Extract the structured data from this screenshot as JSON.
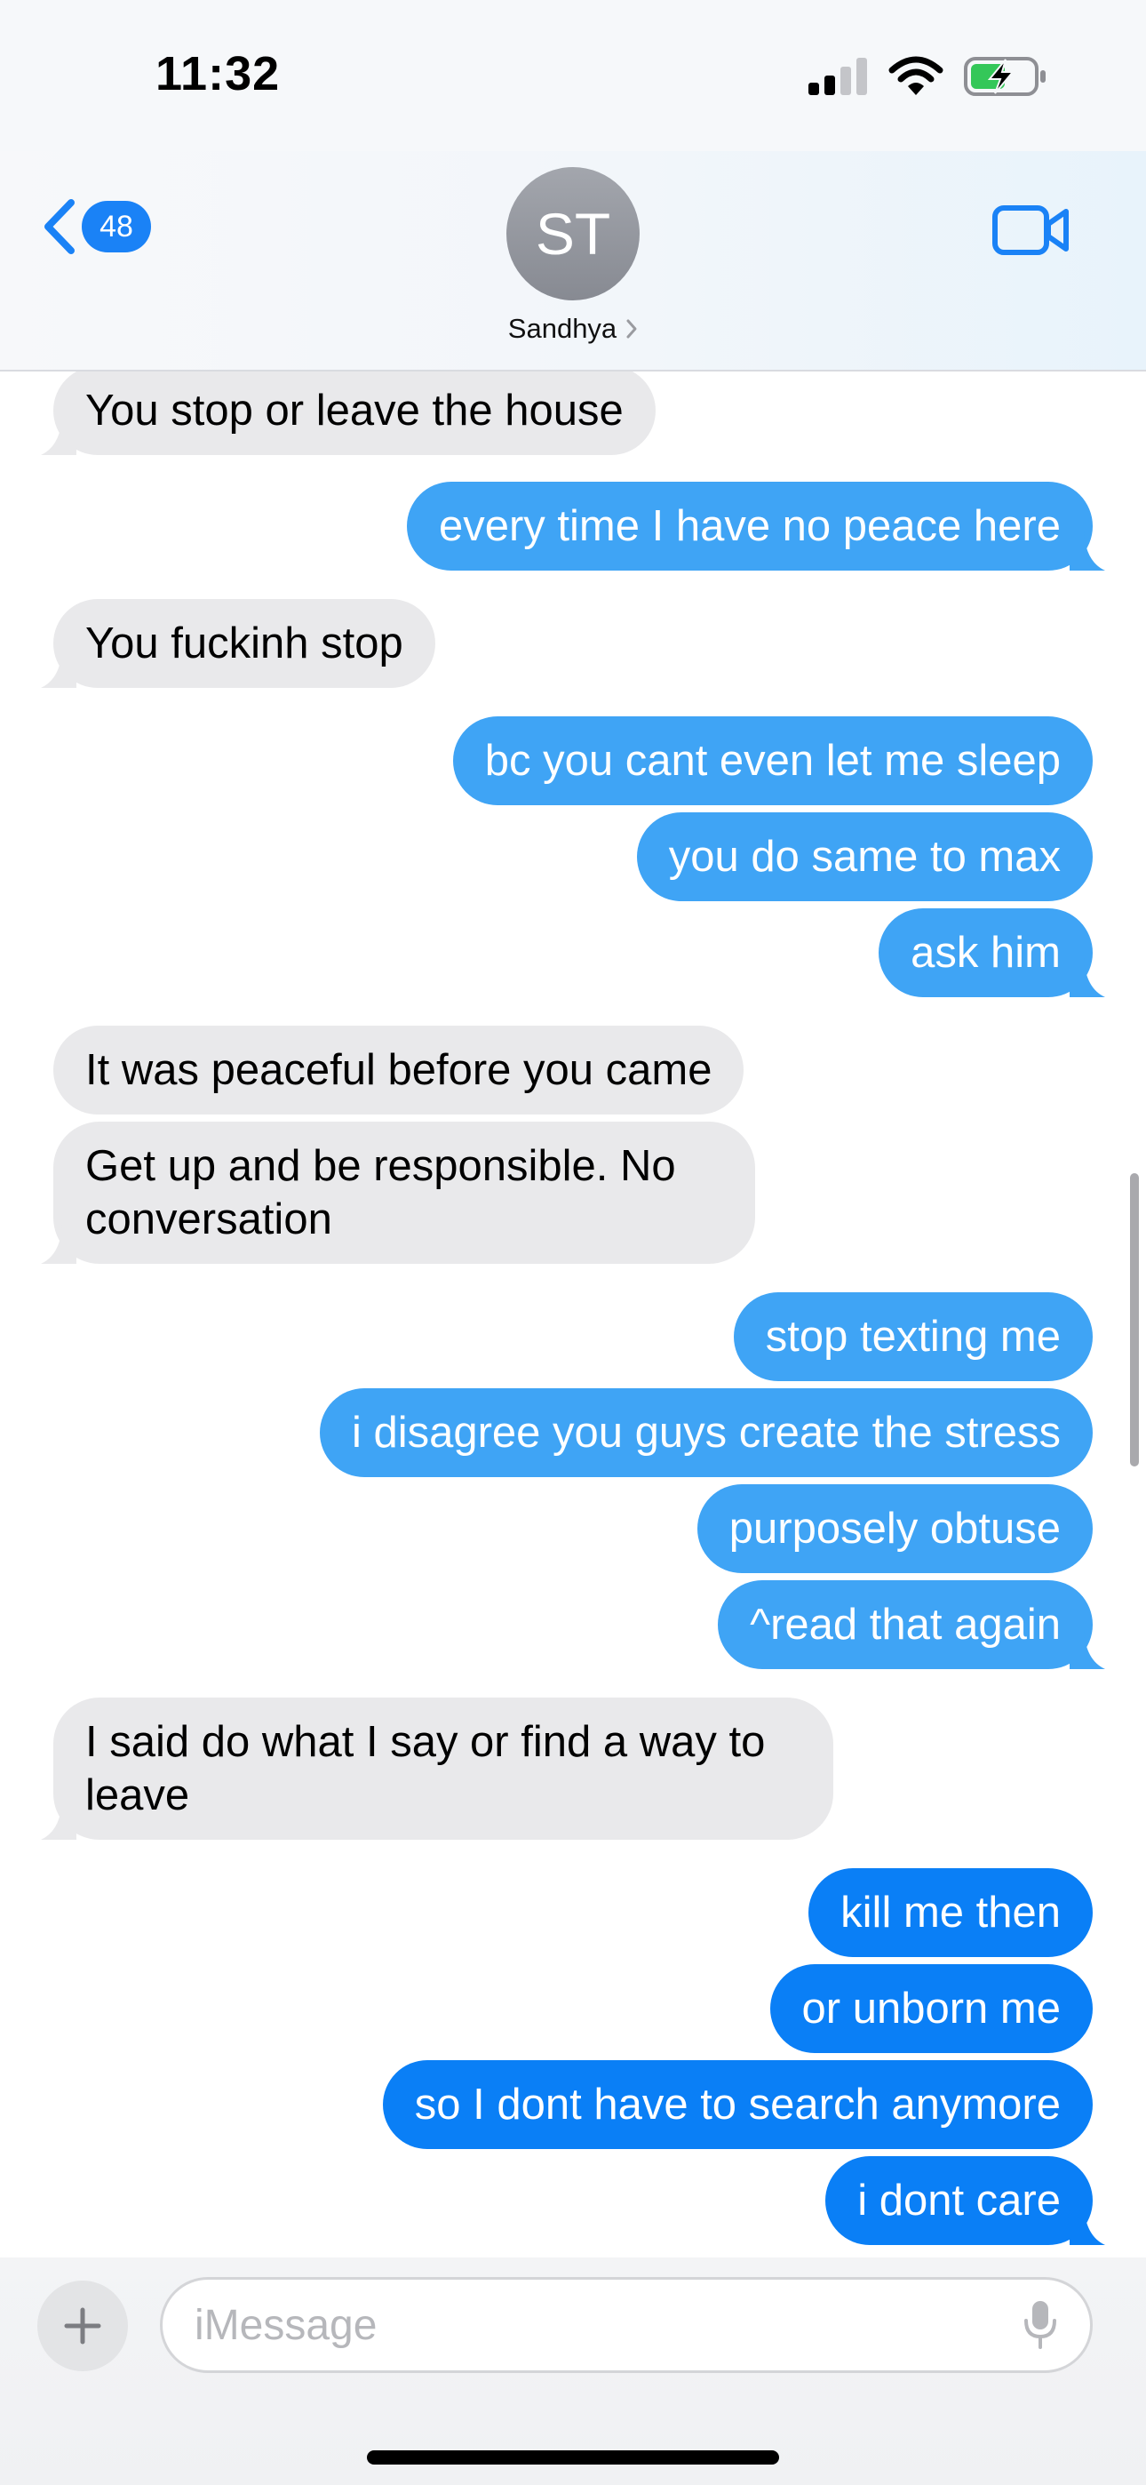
{
  "status_bar": {
    "time": "11:32",
    "icons": [
      "signal-icon",
      "wifi-icon",
      "battery-charging-icon"
    ],
    "battery_color": "#34c759"
  },
  "header": {
    "back_count": "48",
    "avatar_initials": "ST",
    "contact_name": "Sandhya",
    "icons": [
      "chevron-left-icon",
      "chevron-right-icon",
      "video-camera-icon"
    ],
    "accent_color": "#1a82f6"
  },
  "messages": [
    {
      "from": "them",
      "text": "You stop or leave the house"
    },
    {
      "from": "me",
      "text": "every time I have no peace here"
    },
    {
      "from": "them",
      "text": "You fuckinh stop"
    },
    {
      "from": "me",
      "text": "bc you cant even let me sleep"
    },
    {
      "from": "me",
      "text": "you do same to max"
    },
    {
      "from": "me",
      "text": "ask him"
    },
    {
      "from": "them",
      "text": "It was peaceful before you came"
    },
    {
      "from": "them",
      "text": "Get up and be responsible.  No conversation"
    },
    {
      "from": "me",
      "text": "stop texting me"
    },
    {
      "from": "me",
      "text": "i disagree you guys create the stress"
    },
    {
      "from": "me",
      "text": "purposely obtuse"
    },
    {
      "from": "me",
      "text": "^read that again"
    },
    {
      "from": "them",
      "text": "I said do what I say or find a way to leave"
    },
    {
      "from": "me",
      "text": "kill me then"
    },
    {
      "from": "me",
      "text": "or unborn me"
    },
    {
      "from": "me",
      "text": "so I dont have to search anymore"
    },
    {
      "from": "me",
      "text": "i dont care"
    }
  ],
  "composer": {
    "placeholder": "iMessage",
    "value": "",
    "icons": [
      "plus-icon",
      "microphone-icon"
    ]
  },
  "colors": {
    "incoming_bubble": "#e9e9eb",
    "outgoing_bubble_light": "#3fa4f5",
    "outgoing_bubble_dark": "#0a7ff6"
  }
}
